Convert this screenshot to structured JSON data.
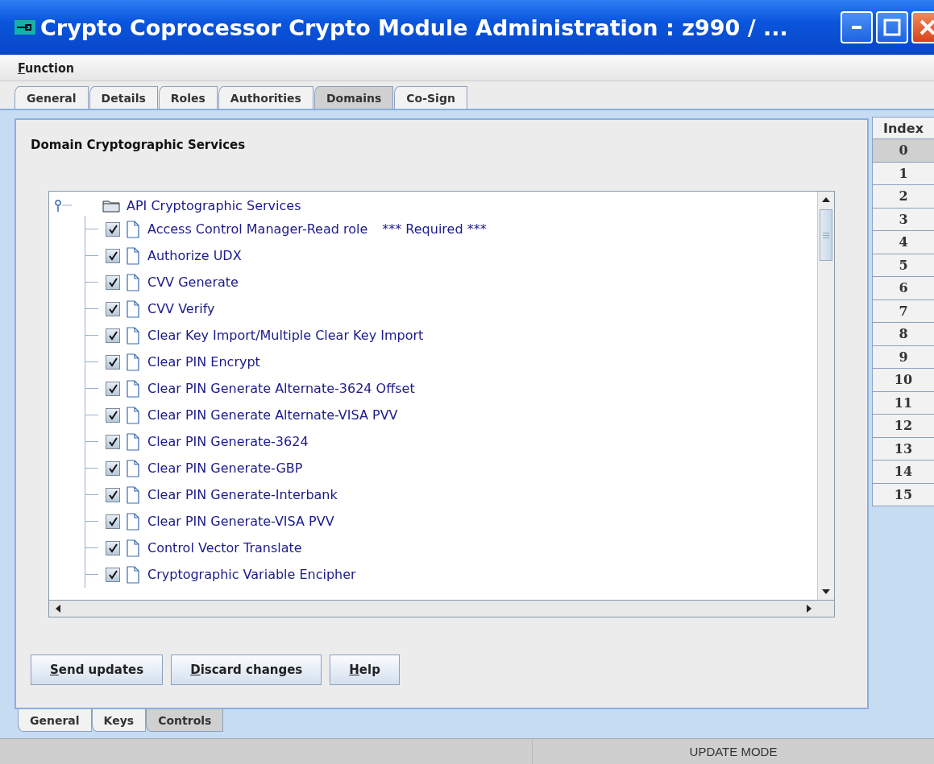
{
  "window": {
    "title": "Crypto Coprocessor Crypto Module Administration : z990 / ..."
  },
  "menu": [
    {
      "label": "Function",
      "mnemonic": true
    }
  ],
  "tabs": [
    {
      "label": "General",
      "selected": false
    },
    {
      "label": "Details",
      "selected": false
    },
    {
      "label": "Roles",
      "selected": false
    },
    {
      "label": "Authorities",
      "selected": false
    },
    {
      "label": "Domains",
      "selected": true
    },
    {
      "label": "Co-Sign",
      "selected": false
    }
  ],
  "panel": {
    "title": "Domain Cryptographic Services",
    "tree": {
      "label": "API Cryptographic Services",
      "expanded": true,
      "children": [
        {
          "label": "Access Control Manager-Read role",
          "note": "*** Required ***",
          "checked": true
        },
        {
          "label": "Authorize UDX",
          "checked": true
        },
        {
          "label": "CVV Generate",
          "checked": true
        },
        {
          "label": "CVV Verify",
          "checked": true
        },
        {
          "label": "Clear Key Import/Multiple Clear Key Import",
          "checked": true
        },
        {
          "label": "Clear PIN Encrypt",
          "checked": true
        },
        {
          "label": "Clear PIN Generate Alternate-3624 Offset",
          "checked": true
        },
        {
          "label": "Clear PIN Generate Alternate-VISA PVV",
          "checked": true
        },
        {
          "label": "Clear PIN Generate-3624",
          "checked": true
        },
        {
          "label": "Clear PIN Generate-GBP",
          "checked": true
        },
        {
          "label": "Clear PIN Generate-Interbank",
          "checked": true
        },
        {
          "label": "Clear PIN Generate-VISA PVV",
          "checked": true
        },
        {
          "label": "Control Vector Translate",
          "checked": true
        },
        {
          "label": "Cryptographic Variable Encipher",
          "checked": true
        }
      ]
    },
    "buttons": [
      {
        "label": "Send updates",
        "mnemonic": true
      },
      {
        "label": "Discard changes",
        "mnemonic": true
      },
      {
        "label": "Help",
        "mnemonic": true
      }
    ]
  },
  "bottom_tabs": [
    {
      "label": "General",
      "selected": false
    },
    {
      "label": "Keys",
      "selected": false
    },
    {
      "label": "Controls",
      "selected": true
    }
  ],
  "index_tabs": {
    "header": "Index",
    "items": [
      {
        "label": "0",
        "selected": true
      },
      {
        "label": "1",
        "selected": false
      },
      {
        "label": "2",
        "selected": false
      },
      {
        "label": "3",
        "selected": false
      },
      {
        "label": "4",
        "selected": false
      },
      {
        "label": "5",
        "selected": false
      },
      {
        "label": "6",
        "selected": false
      },
      {
        "label": "7",
        "selected": false
      },
      {
        "label": "8",
        "selected": false
      },
      {
        "label": "9",
        "selected": false
      },
      {
        "label": "10",
        "selected": false
      },
      {
        "label": "11",
        "selected": false
      },
      {
        "label": "12",
        "selected": false
      },
      {
        "label": "13",
        "selected": false
      },
      {
        "label": "14",
        "selected": false
      },
      {
        "label": "15",
        "selected": false
      }
    ]
  },
  "status_bar": {
    "mode": "UPDATE MODE"
  }
}
